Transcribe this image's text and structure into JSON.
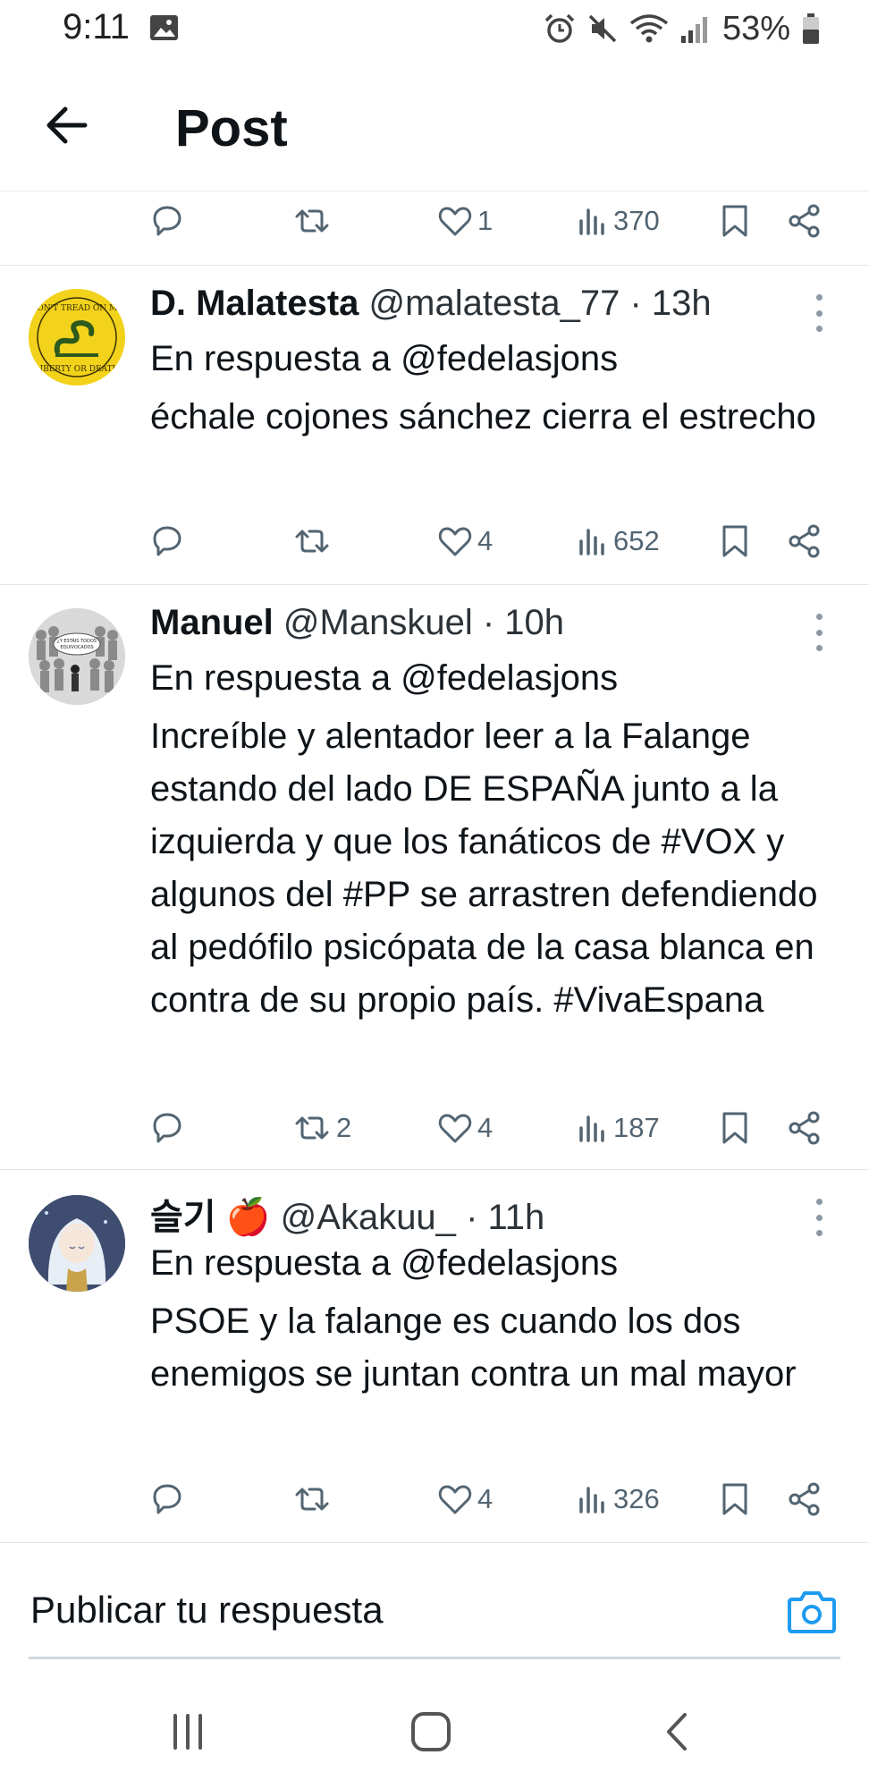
{
  "status_bar": {
    "time": "9:11",
    "battery": "53%",
    "icons": [
      "gallery-icon",
      "alarm-icon",
      "mute-icon",
      "wifi-icon",
      "signal-icon",
      "battery-icon"
    ]
  },
  "header": {
    "title": "Post",
    "back_icon": "arrow-left-icon"
  },
  "top_actions": {
    "likes": "1",
    "views": "370"
  },
  "replies": [
    {
      "name": "D. Malatesta",
      "handle": "@malatesta_77",
      "time": "· 13h",
      "reply_to": "En respuesta a @fedelasjons",
      "text": "échale cojones sánchez cierra el estrecho",
      "retweets": "",
      "likes": "4",
      "views": "652",
      "avatar_text_top": "DON'T TREAD ON ME",
      "avatar_text_bottom": "LIBERTY OR DEATH"
    },
    {
      "name": "Manuel",
      "handle": "@Manskuel",
      "time": "· 10h",
      "reply_to": "En respuesta a @fedelasjons",
      "text": "Increíble y alentador leer a la Falange estando del lado DE ESPAÑA junto a la izquierda y que los fanáticos de #VOX y algunos del #PP se arrastren defendiendo al pedófilo psicópata de la casa blanca en contra de su propio país. #VivaEspana",
      "retweets": "2",
      "likes": "4",
      "views": "187",
      "avatar_text": "¿Y ESTÁIS TODOS EQUIVOCADOS"
    },
    {
      "name": "슬기 🍎",
      "handle": "@Akakuu_",
      "time": "· 11h",
      "reply_to": "En respuesta a @fedelasjons",
      "text": "PSOE y la falange es cuando los dos enemigos se juntan contra un mal mayor",
      "retweets": "",
      "likes": "4",
      "views": "326"
    }
  ],
  "compose": {
    "placeholder": "Publicar tu respuesta",
    "camera_icon": "camera-icon"
  },
  "nav_bar": [
    "recents-icon",
    "home-icon",
    "back-icon"
  ],
  "colors": {
    "accent": "#1d9bf0",
    "text": "#0f1419",
    "secondary": "#536471",
    "divider": "#e3e6e8",
    "flag_yellow": "#f2d21b"
  }
}
